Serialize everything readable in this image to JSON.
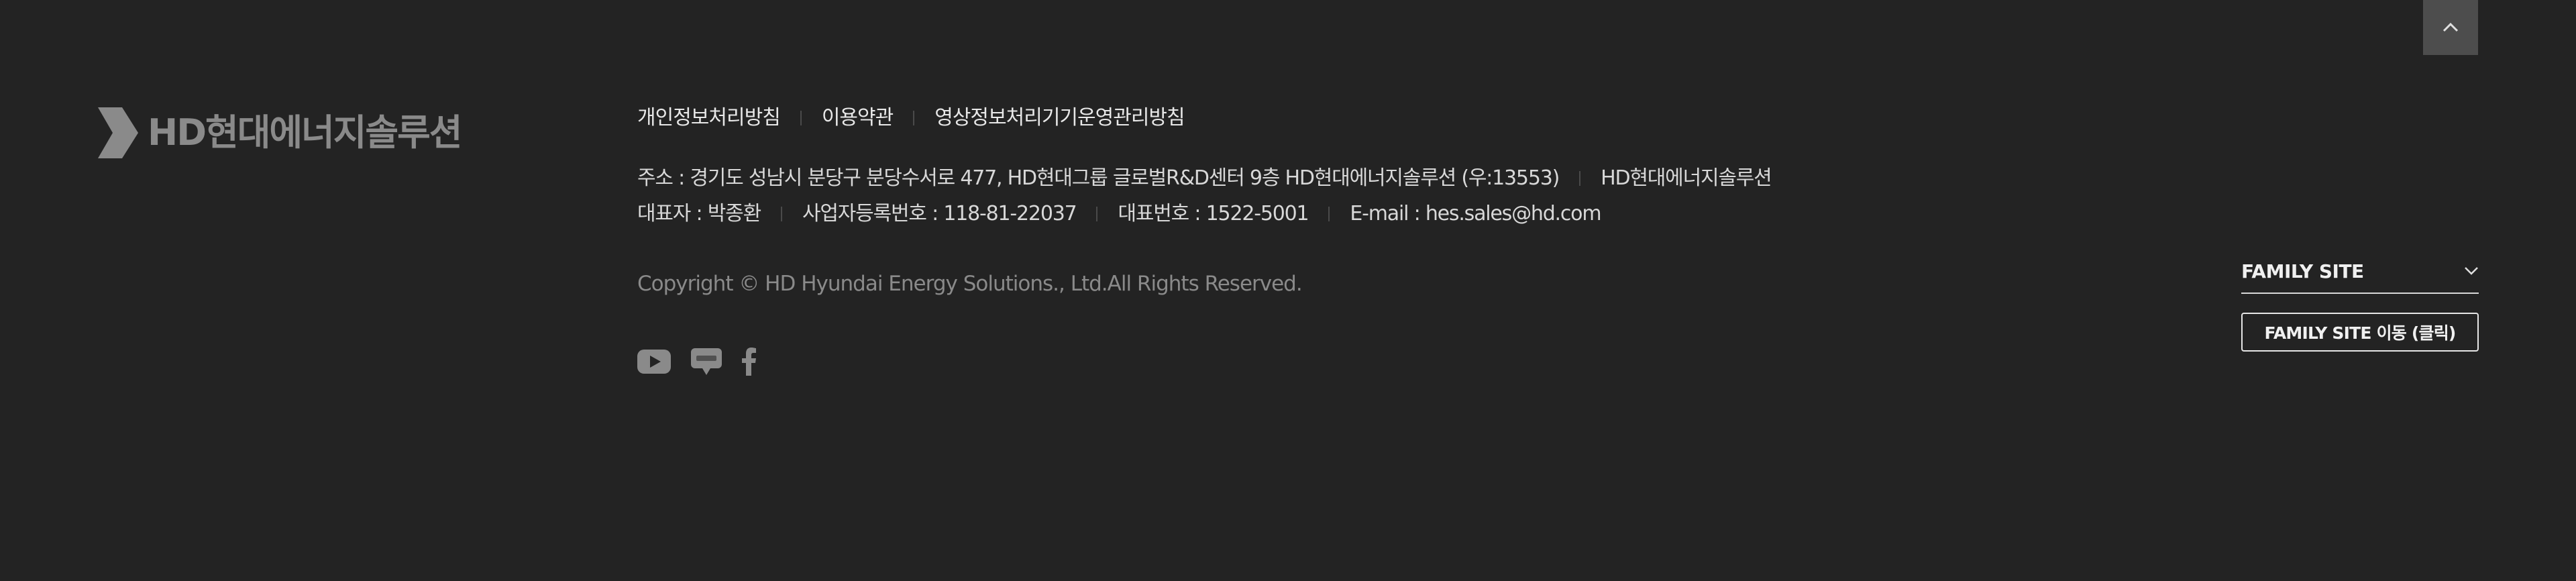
{
  "logo": {
    "text": "HD현대에너지솔루션"
  },
  "top_button": {
    "icon": "chevron-up-icon"
  },
  "policy_links": [
    {
      "label": "개인정보처리방침"
    },
    {
      "label": "이용약관"
    },
    {
      "label": "영상정보처리기기운영관리방침"
    }
  ],
  "info": {
    "address": "주소 : 경기도 성남시 분당구 분당수서로 477, HD현대그룹 글로벌R&D센터 9층 HD현대에너지솔루션 (우:13553)",
    "company": "HD현대에너지솔루션",
    "ceo": "대표자 : 박종환",
    "business_no": "사업자등록번호 : 118-81-22037",
    "phone": "대표번호 : 1522-5001",
    "email": "E-mail : hes.sales@hd.com"
  },
  "copyright": "Copyright © HD Hyundai Energy Solutions., Ltd.All Rights Reserved.",
  "sns": [
    {
      "icon": "youtube-icon"
    },
    {
      "icon": "blog-icon"
    },
    {
      "icon": "facebook-icon"
    }
  ],
  "family_site": {
    "label": "FAMILY SITE",
    "button_label": "FAMILY SITE 이동 (클릭)"
  },
  "colors": {
    "background": "#232323",
    "logo": "#8a8a8a",
    "top_button": "#4d4d4d"
  }
}
